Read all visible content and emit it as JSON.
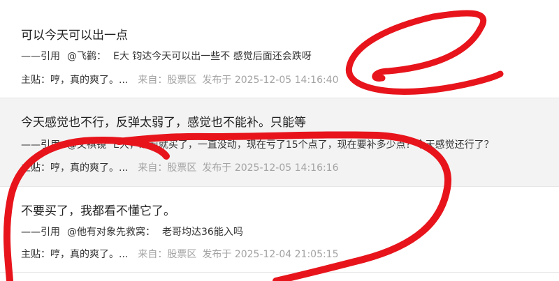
{
  "posts": [
    {
      "title": "可以今天可以出一点",
      "quote_prefix": "——引用",
      "quote_user": "@飞鹳：",
      "quote_text": "E大 钧达今天可以出一些不 感觉后面还会跌呀",
      "main_label": "主贴：",
      "main_text": "哼，真的爽了。...",
      "from_label": "来自：",
      "board": "股票区",
      "posted_label": "发布于",
      "time": "2025-12-05 14:16:40"
    },
    {
      "title": "今天感觉也不行，反弹太弱了，感觉也不能补。只能等",
      "quote_prefix": "——引用",
      "quote_user": "@文祺镜",
      "quote_text": "E大，之前就买了，一直没动，现在亏了15个点了，现在要补多少点？今天感觉还行了？",
      "main_label": "主贴：",
      "main_text": "哼，真的爽了。...",
      "from_label": "来自：",
      "board": "股票区",
      "posted_label": "发布于",
      "time": "2025-12-05 14:16:16"
    },
    {
      "title": "不要买了，我都看不懂它了。",
      "quote_prefix": "——引用",
      "quote_user": "@他有对象先救窝：",
      "quote_text": "老哥均达36能入吗",
      "main_label": "主贴：",
      "main_text": "哼，真的爽了。...",
      "from_label": "来自：",
      "board": "股票区",
      "posted_label": "发布于",
      "time": "2025-12-04 21:05:15"
    }
  ],
  "annotation_color": "#e8141c"
}
